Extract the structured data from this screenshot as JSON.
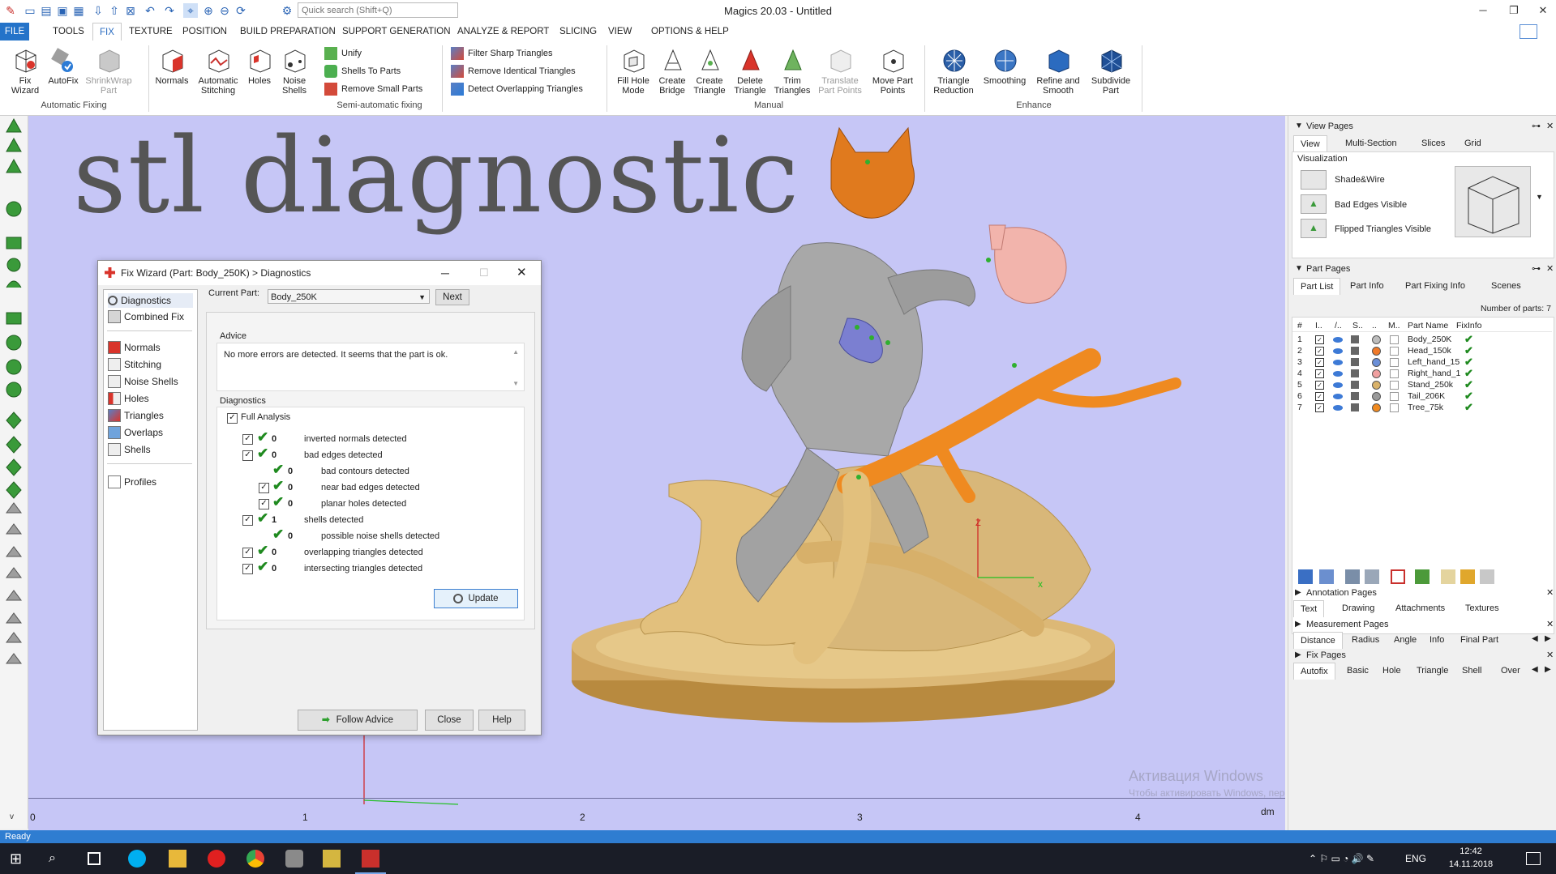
{
  "window": {
    "title": "Magics 20.03 - Untitled",
    "search_placeholder": "Quick search (Shift+Q)"
  },
  "menu": {
    "tabs": [
      "FILE",
      "TOOLS",
      "FIX",
      "TEXTURE",
      "POSITION",
      "BUILD PREPARATION",
      "SUPPORT GENERATION",
      "ANALYZE & REPORT",
      "SLICING",
      "VIEW",
      "OPTIONS & HELP"
    ],
    "active_tab": "FIX"
  },
  "ribbon": {
    "automatic_fixing": {
      "label": "Automatic Fixing",
      "fix_wizard": "Fix Wizard",
      "autofix": "AutoFix",
      "shrinkwrap": "ShrinkWrap Part"
    },
    "normals": "Normals",
    "auto_stitching": "Automatic Stitching",
    "holes": "Holes",
    "noise_shells": "Noise Shells",
    "semi": {
      "label": "Semi-automatic fixing",
      "unify": "Unify",
      "shells_to_parts": "Shells To Parts",
      "remove_small_parts": "Remove Small Parts"
    },
    "filter_sharp": "Filter Sharp Triangles",
    "remove_identical": "Remove Identical Triangles",
    "detect_overlapping": "Detect Overlapping Triangles",
    "manual": {
      "label": "Manual",
      "fill_hole": "Fill Hole Mode",
      "create_bridge": "Create Bridge",
      "create_triangle": "Create Triangle",
      "delete_triangle": "Delete Triangle",
      "trim_triangles": "Trim Triangles",
      "translate_points": "Translate Part Points",
      "move_points": "Move Part Points"
    },
    "enhance": {
      "label": "Enhance",
      "triangle_reduction": "Triangle Reduction",
      "smoothing": "Smoothing",
      "refine": "Refine and Smooth",
      "subdivide": "Subdivide Part"
    }
  },
  "viewport": {
    "overlay_title": "stl diagnostic",
    "ruler": {
      "ticks": [
        "0",
        "1",
        "2",
        "3",
        "4"
      ],
      "unit": "dm"
    },
    "axis_label": "Z",
    "axis_x": "x",
    "watermark1": "Активация Windows",
    "watermark2": "Чтобы активировать Windows, перейдите в раздел \"Параметры\"."
  },
  "dialog": {
    "title": "Fix Wizard (Part: Body_250K) > Diagnostics",
    "nav": {
      "diagnostics": "Diagnostics",
      "combined_fix": "Combined Fix",
      "normals": "Normals",
      "stitching": "Stitching",
      "noise_shells": "Noise Shells",
      "holes": "Holes",
      "triangles": "Triangles",
      "overlaps": "Overlaps",
      "shells": "Shells",
      "profiles": "Profiles"
    },
    "current_part_label": "Current Part:",
    "current_part": "Body_250K",
    "next": "Next",
    "advice_title": "Advice",
    "advice_text": "No more errors are detected. It seems that the part is ok.",
    "diagnostics_title": "Diagnostics",
    "full_analysis": "Full Analysis",
    "rows": [
      {
        "count": "0",
        "text": "inverted normals detected"
      },
      {
        "count": "0",
        "text": "bad edges detected"
      },
      {
        "count": "0",
        "text": "bad contours detected"
      },
      {
        "count": "0",
        "text": "near bad edges detected"
      },
      {
        "count": "0",
        "text": "planar holes detected"
      },
      {
        "count": "1",
        "text": "shells detected"
      },
      {
        "count": "0",
        "text": "possible noise shells detected"
      },
      {
        "count": "0",
        "text": "overlapping triangles detected"
      },
      {
        "count": "0",
        "text": "intersecting triangles detected"
      }
    ],
    "update": "Update",
    "follow_advice": "Follow Advice",
    "close": "Close",
    "help": "Help"
  },
  "view_pages": {
    "title": "View Pages",
    "tabs": [
      "View",
      "Multi-Section",
      "Slices",
      "Grid"
    ],
    "visualization": "Visualization",
    "options": [
      "Shade&Wire",
      "Bad Edges Visible",
      "Flipped Triangles Visible"
    ]
  },
  "part_pages": {
    "title": "Part Pages",
    "tabs": [
      "Part List",
      "Part Info",
      "Part Fixing Info",
      "Scenes"
    ],
    "count_label": "Number of parts: 7",
    "columns": [
      "#",
      "I..",
      "/..",
      "S..",
      "..",
      "M..",
      "Part Name",
      "FixInfo"
    ],
    "parts": [
      {
        "n": "1",
        "name": "Body_250K",
        "color": "#bdbdbd"
      },
      {
        "n": "2",
        "name": "Head_150k",
        "color": "#f07a2a"
      },
      {
        "n": "3",
        "name": "Left_hand_15",
        "color": "#6a8fd8"
      },
      {
        "n": "4",
        "name": "Right_hand_1",
        "color": "#f0a0a0"
      },
      {
        "n": "5",
        "name": "Stand_250k",
        "color": "#d9b26a"
      },
      {
        "n": "6",
        "name": "Tail_206K",
        "color": "#9a9a9a"
      },
      {
        "n": "7",
        "name": "Tree_75k",
        "color": "#f08a20"
      }
    ]
  },
  "annotation_pages": {
    "title": "Annotation Pages",
    "tabs": [
      "Text",
      "Drawing",
      "Attachments",
      "Textures"
    ]
  },
  "measurement_pages": {
    "title": "Measurement Pages",
    "tabs": [
      "Distance",
      "Radius",
      "Angle",
      "Info",
      "Final Part"
    ]
  },
  "fix_pages": {
    "title": "Fix Pages",
    "tabs": [
      "Autofix",
      "Basic",
      "Hole",
      "Triangle",
      "Shell",
      "Over"
    ]
  },
  "status": {
    "text": "Ready"
  },
  "taskbar": {
    "lang": "ENG",
    "time": "12:42",
    "date": "14.11.2018"
  },
  "colors": {
    "viewport_bg": "#c6c6f6",
    "accent": "#2473c9",
    "stand": "#cfa45e",
    "check": "#1f8a1f"
  }
}
